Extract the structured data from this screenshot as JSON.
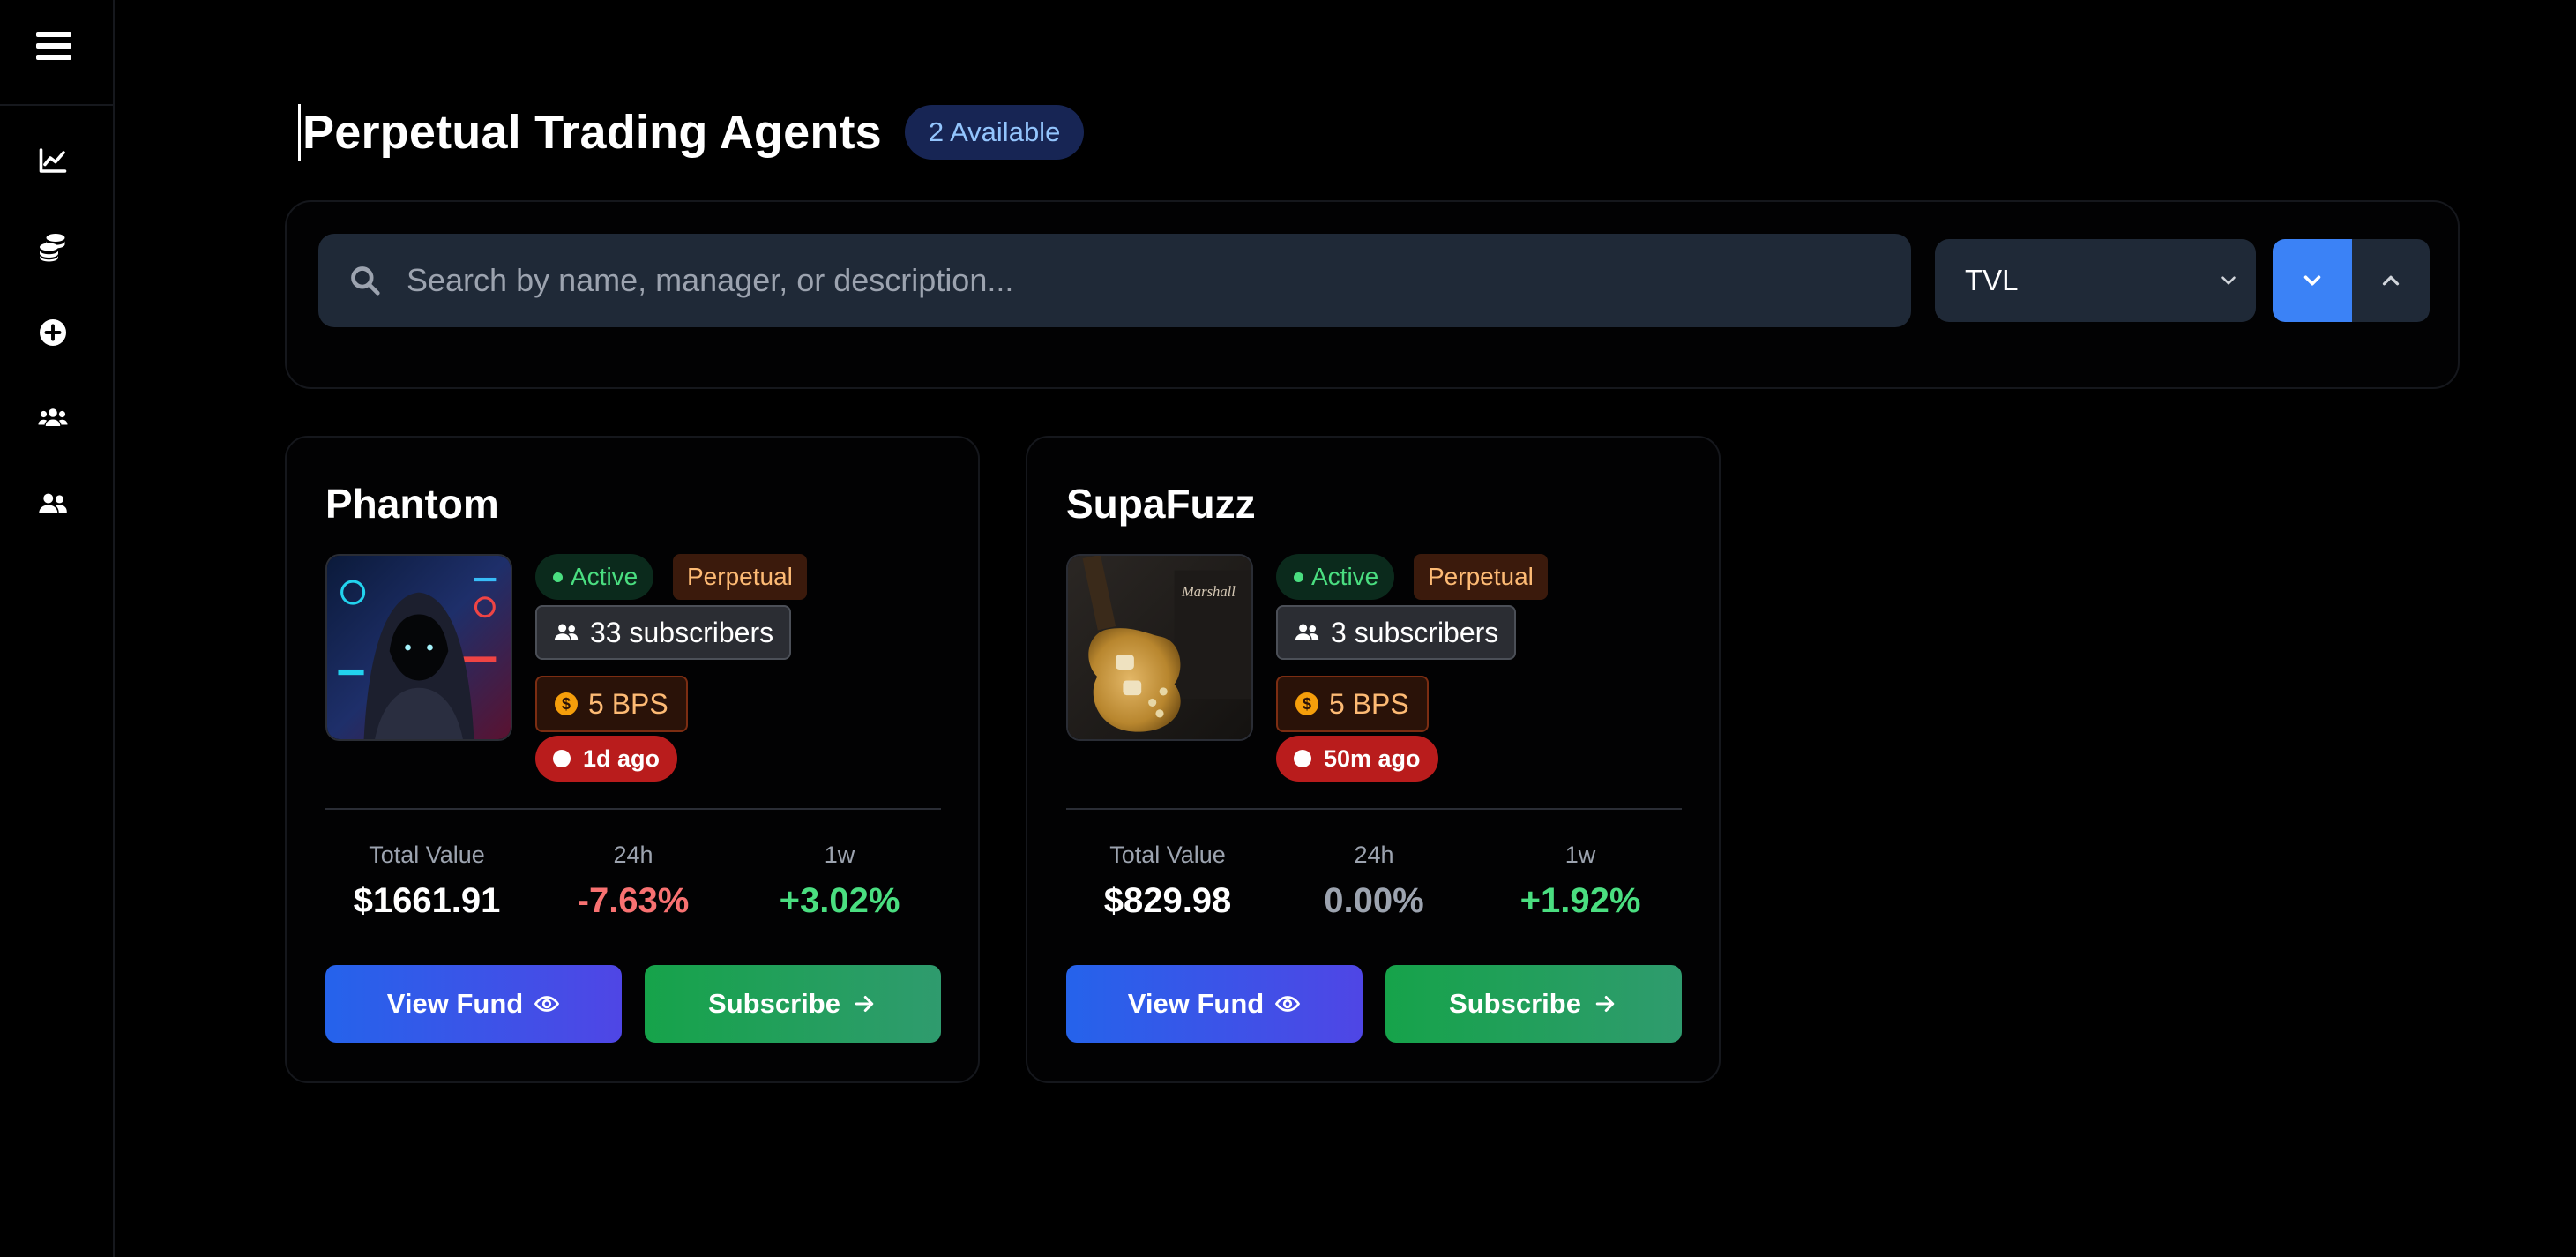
{
  "page": {
    "title": "Perpetual Trading Agents",
    "available_badge": "2 Available"
  },
  "sidebar": {
    "items": [
      {
        "icon": "chart-line-icon"
      },
      {
        "icon": "coins-icon"
      },
      {
        "icon": "plus-circle-icon"
      },
      {
        "icon": "users-group-icon"
      },
      {
        "icon": "user-friends-icon"
      }
    ]
  },
  "toolbar": {
    "search_placeholder": "Search by name, manager, or description...",
    "sort_value": "TVL"
  },
  "stat_labels": {
    "total": "Total Value",
    "d24": "24h",
    "w1": "1w"
  },
  "buttons": {
    "view": "View Fund",
    "subscribe": "Subscribe"
  },
  "colors": {
    "positive": "#4ade80",
    "negative": "#f87171",
    "neutral": "#9ca3af",
    "accent": "#3b82f6"
  },
  "funds": [
    {
      "name": "Phantom",
      "status": "Active",
      "type": "Perpetual",
      "subscribers": "33 subscribers",
      "fee": "5 BPS",
      "updated": "1d ago",
      "total_value": "$1661.91",
      "change_24h": "-7.63%",
      "change_1w": "+3.02%"
    },
    {
      "name": "SupaFuzz",
      "status": "Active",
      "type": "Perpetual",
      "subscribers": "3 subscribers",
      "fee": "5 BPS",
      "updated": "50m ago",
      "total_value": "$829.98",
      "change_24h": "0.00%",
      "change_1w": "+1.92%"
    }
  ]
}
